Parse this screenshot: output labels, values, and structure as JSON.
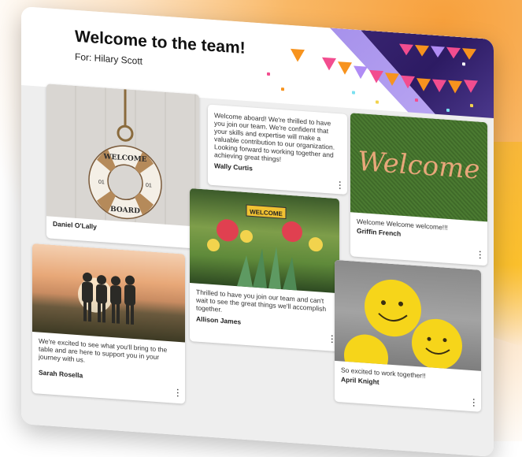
{
  "header": {
    "title": "Welcome to the team!",
    "recipient": "For: Hilary Scott"
  },
  "cards": [
    {
      "id": "daniel",
      "image": "welcome-lifebuoy-photo",
      "message": "",
      "author": "Daniel O'Lally",
      "image_text": [
        "WELCOME",
        "BOARD",
        "01",
        "01"
      ]
    },
    {
      "id": "sarah",
      "image": "group-sunset-photo",
      "message": "We're excited to see what you'll bring to the table and are here to support you in your journey with us.",
      "author": "Sarah Rosella"
    },
    {
      "id": "wally",
      "image": "",
      "message": "Welcome aboard! We're thrilled to have you join our team. We're confident that your skills and expertise will make a valuable contribution to our organization. Looking forward to working together and achieving great things!",
      "author": "Wally Curtis"
    },
    {
      "id": "allison",
      "image": "cactus-flowers-photo",
      "message": "Thrilled to have you join our team and can't wait to see the great things we'll accomplish together.",
      "author": "Allison James",
      "image_text": [
        "WELCOME"
      ]
    },
    {
      "id": "griffin",
      "image": "welcome-script-grass-photo",
      "message": "Welcome Welcome welcome!!!",
      "author": "Griffin French",
      "image_text": [
        "Welcome"
      ]
    },
    {
      "id": "april",
      "image": "smiley-balls-photo",
      "message": "So excited to work together!!",
      "author": "April Knight"
    }
  ],
  "icons": {
    "more": "kebab-menu-icon"
  },
  "colors": {
    "banner": "#2d1b63",
    "accent_orange": "#f7a03c",
    "board_bg": "#eeeeee"
  }
}
